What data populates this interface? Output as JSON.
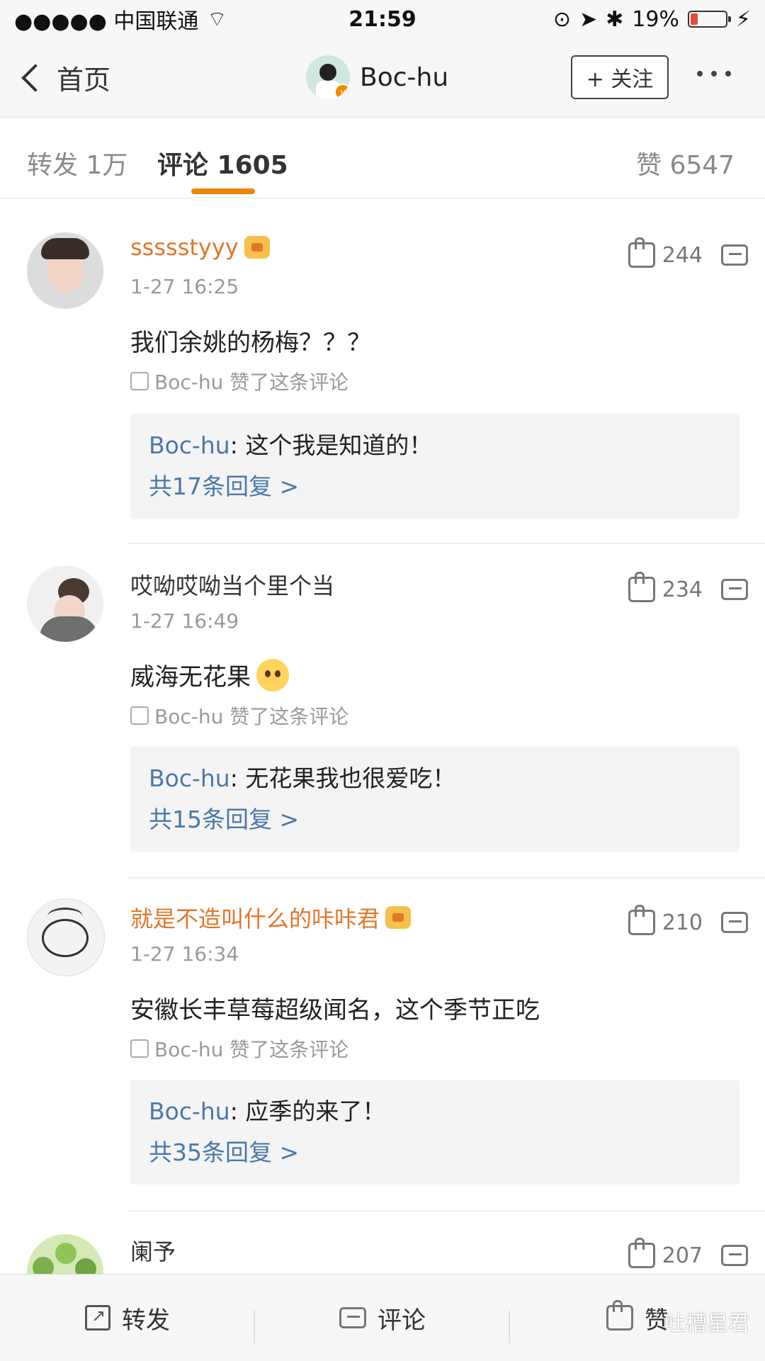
{
  "status": {
    "carrier": "●●●●● 中国联通",
    "time": "21:59",
    "battery": "19%"
  },
  "nav": {
    "back_label": "首页",
    "title": "Boc-hu",
    "follow_label": "+ 关注"
  },
  "tabs": {
    "forward": "转发 1万",
    "comments": "评论 1605",
    "likes": "赞 6547"
  },
  "comments": [
    {
      "name": "ssssstyyy",
      "time": "1-27 16:25",
      "content": "我们余姚的杨梅？？？",
      "liked_by": "Boc-hu 赞了这条评论",
      "likes": "244",
      "reply": {
        "author": "Boc-hu",
        "text": ": 这个我是知道的！",
        "count": "共17条回复 >"
      }
    },
    {
      "name": "哎呦哎呦当个里个当",
      "time": "1-27 16:49",
      "content": "威海无花果",
      "liked_by": "Boc-hu 赞了这条评论",
      "likes": "234",
      "reply": {
        "author": "Boc-hu",
        "text": ": 无花果我也很爱吃！",
        "count": "共15条回复 >"
      }
    },
    {
      "name": "就是不造叫什么的咔咔君",
      "time": "1-27 16:34",
      "content": "安徽长丰草莓超级闻名，这个季节正吃",
      "liked_by": "Boc-hu 赞了这条评论",
      "likes": "210",
      "reply": {
        "author": "Boc-hu",
        "text": ": 应季的来了！",
        "count": "共35条回复 >"
      }
    },
    {
      "name": "阑予",
      "likes": "207"
    }
  ],
  "bottom": {
    "forward": "转发",
    "comment": "评论",
    "like": "赞",
    "watermark": "吐槽星君"
  }
}
